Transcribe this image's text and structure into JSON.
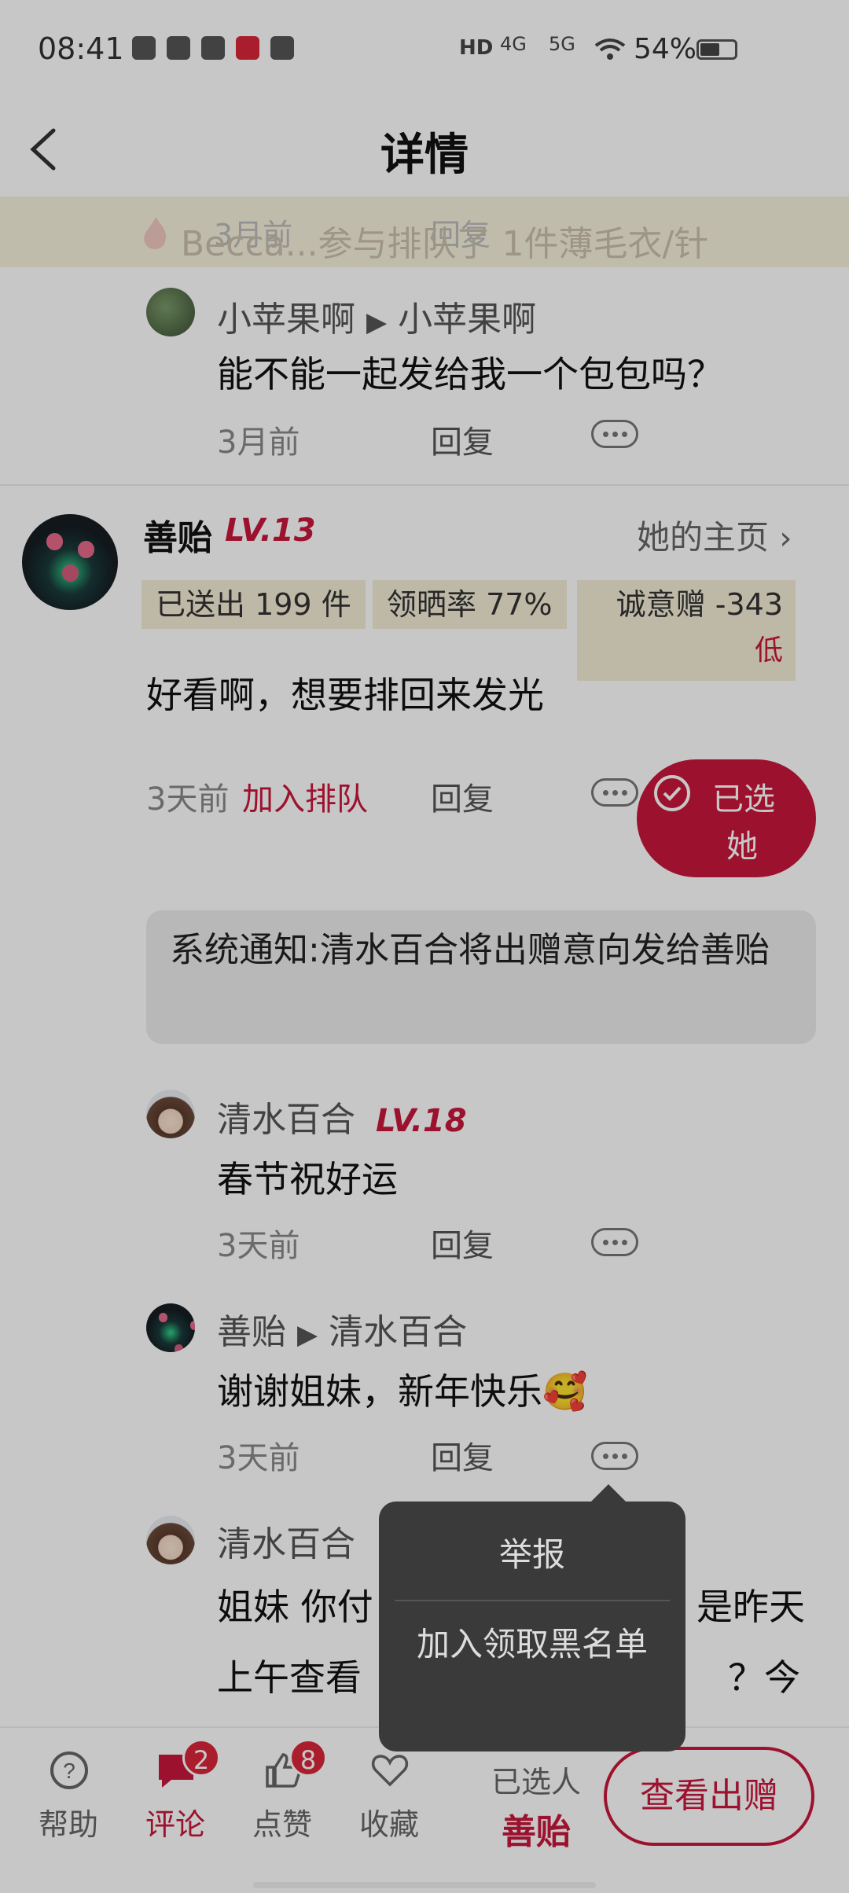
{
  "status_bar": {
    "time": "08:41",
    "battery": "54%",
    "network1": "4G",
    "network2": "5G",
    "hd": "HD"
  },
  "nav": {
    "title": "详情"
  },
  "banner": {
    "text": "Becca...参与排队了 1件薄毛衣/针",
    "ghost_time": "3月前",
    "ghost_reply": "回复"
  },
  "comment1": {
    "user": "小苹果啊",
    "reply_to": "小苹果啊",
    "content": "能不能一起发给我一个包包吗？",
    "time": "3月前",
    "reply": "回复"
  },
  "main_comment": {
    "user": "善贻",
    "level": "LV.13",
    "homepage": "她的主页",
    "tags": [
      "已送出 199 件",
      "领晒率 77%",
      "诚意赠 -343"
    ],
    "tag_low": "低",
    "content": "好看啊，想要排回来发光",
    "time": "3天前",
    "join": "加入排队",
    "reply": "回复",
    "selected_line1": "已选",
    "selected_line2": "她"
  },
  "system_notice": "系统通知:清水百合将出赠意向发给善贻",
  "comment2": {
    "user": "清水百合",
    "level": "LV.18",
    "content": "春节祝好运",
    "time": "3天前",
    "reply": "回复"
  },
  "comment3": {
    "user": "善贻",
    "reply_to": "清水百合",
    "content": "谢谢姐妹，新年快乐🥰",
    "time": "3天前",
    "reply": "回复"
  },
  "comment4": {
    "user": "清水百合",
    "content_line1": "姐妹  你付",
    "content_line1_tail": "是昨天",
    "content_line2": "上午查看",
    "content_line2_tail": "？今"
  },
  "popup": {
    "report": "举报",
    "blacklist": "加入领取黑名单"
  },
  "bottom_bar": {
    "help": "帮助",
    "comment": "评论",
    "comment_count": "2",
    "like": "点赞",
    "like_count": "8",
    "favorite": "收藏",
    "selected_label": "已选人",
    "selected_name": "善贻",
    "view_button": "查看出赠"
  },
  "colors": {
    "accent": "#c8183c",
    "tag_bg": "#f4ecd6"
  }
}
